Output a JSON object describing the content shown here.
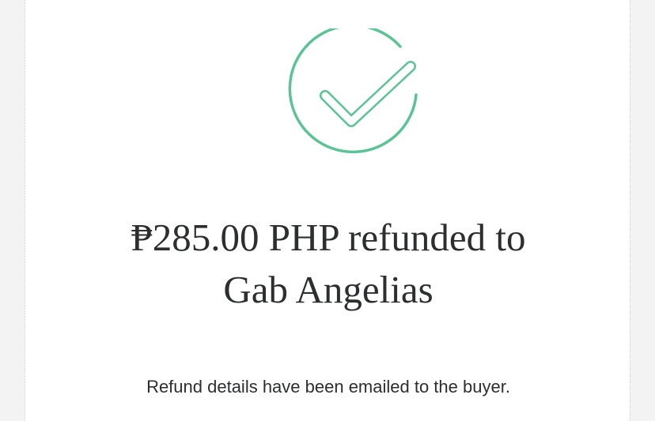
{
  "confirmation": {
    "icon": "check-circle-icon",
    "icon_color": "#5bc394",
    "headline_line1": "₱285.00 PHP refunded to",
    "headline_line2": "Gab Angelias",
    "subtext": "Refund details have been emailed to the buyer."
  }
}
